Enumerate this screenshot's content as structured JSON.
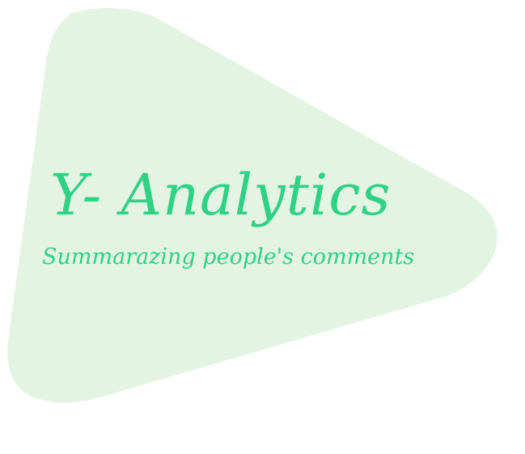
{
  "hero": {
    "title": "Y- Analytics",
    "subtitle": "Summarazing people's comments"
  },
  "colors": {
    "shape_fill": "#e3f4e3",
    "text": "#2fd184",
    "background": "#ffffff"
  }
}
